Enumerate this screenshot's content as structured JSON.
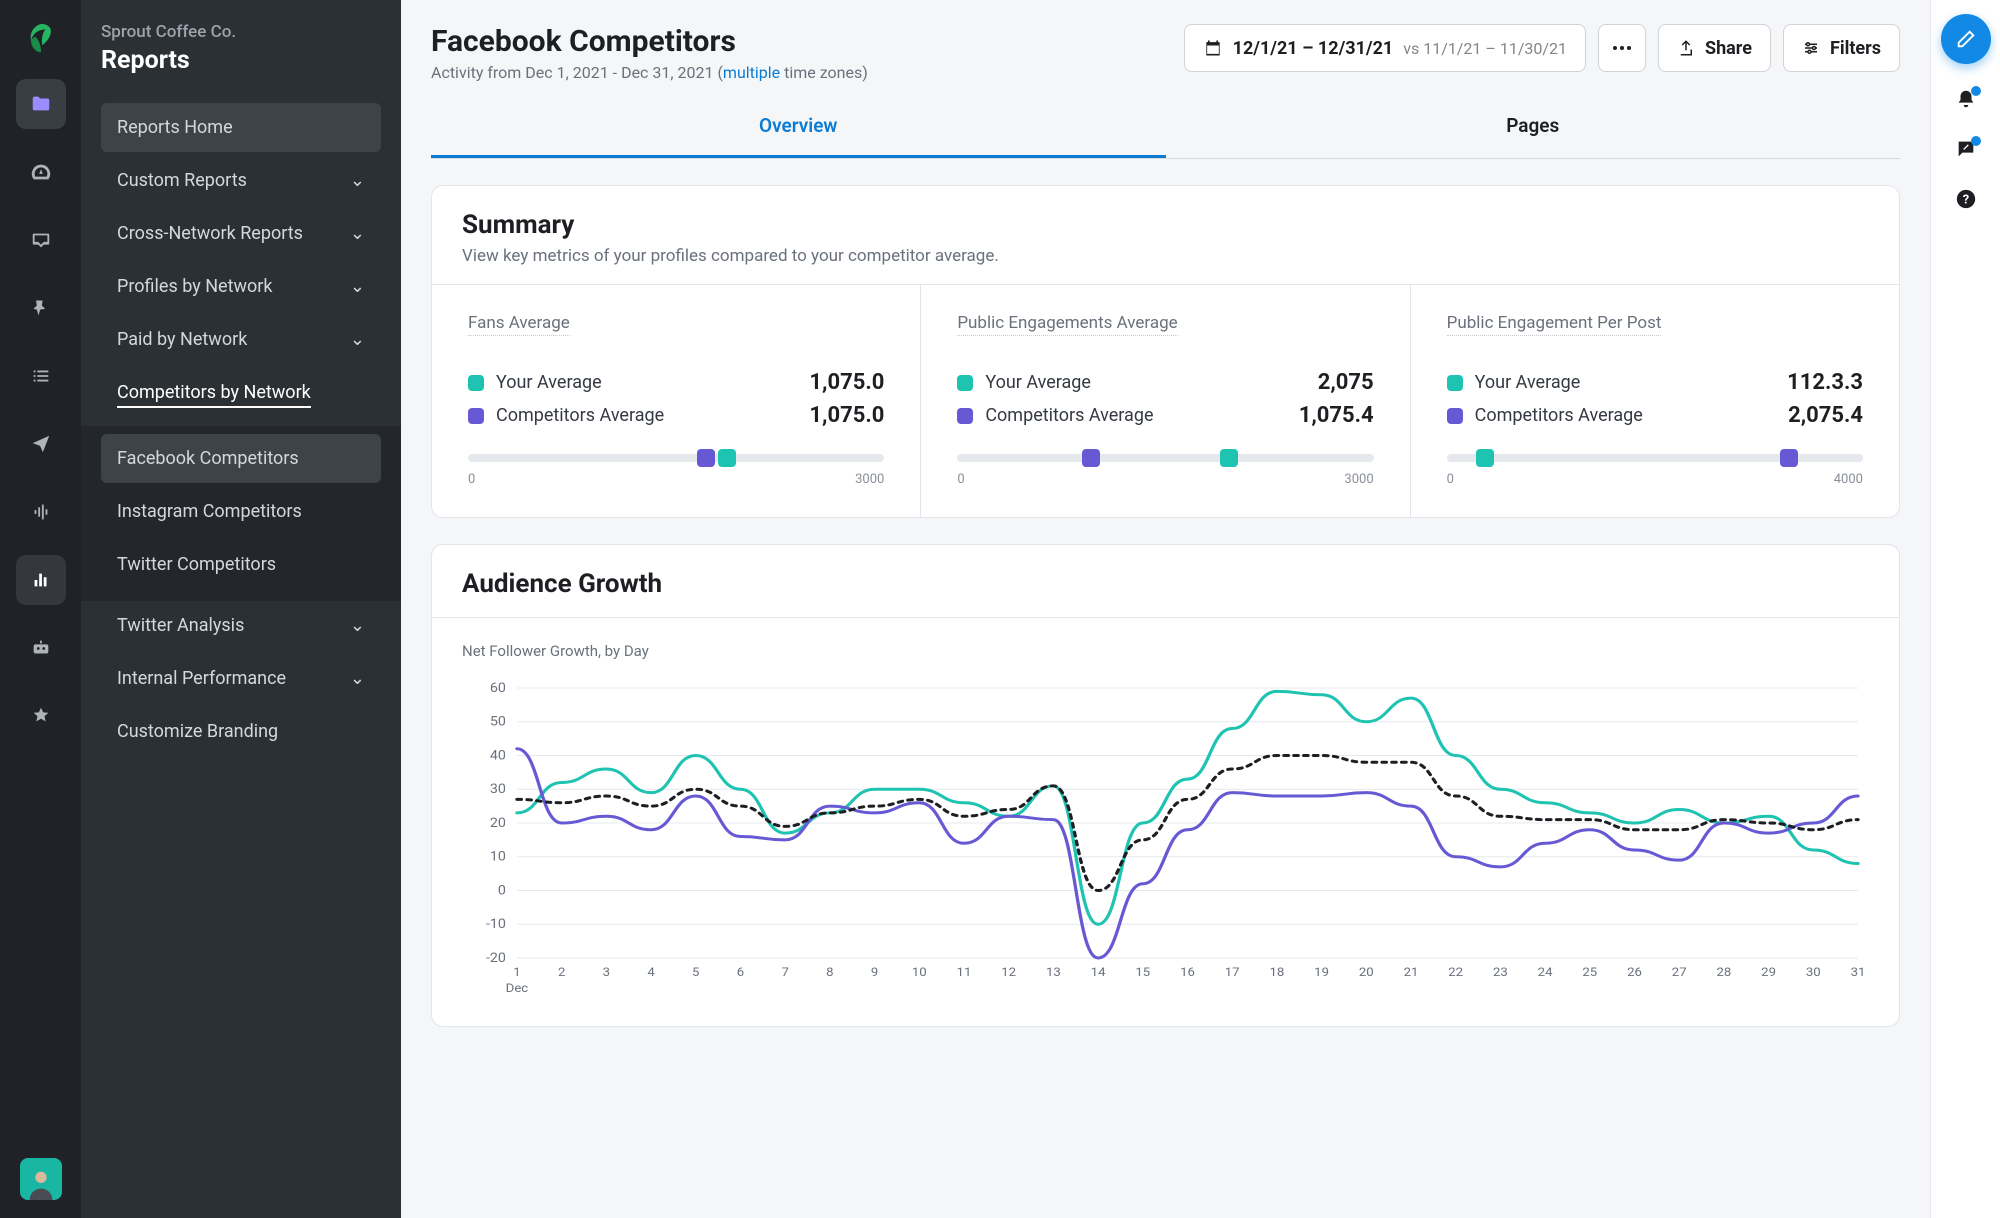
{
  "org": "Sprout Coffee Co.",
  "section": "Reports",
  "sidebar": {
    "home": "Reports Home",
    "items": [
      {
        "label": "Custom Reports"
      },
      {
        "label": "Cross-Network Reports"
      },
      {
        "label": "Profiles by Network"
      },
      {
        "label": "Paid by Network"
      },
      {
        "label": "Competitors by Network"
      }
    ],
    "sub": [
      {
        "label": "Facebook Competitors"
      },
      {
        "label": "Instagram Competitors"
      },
      {
        "label": "Twitter Competitors"
      }
    ],
    "tail": [
      {
        "label": "Twitter Analysis"
      },
      {
        "label": "Internal Performance"
      },
      {
        "label": "Customize Branding"
      }
    ]
  },
  "header": {
    "title": "Facebook Competitors",
    "activity_pre": "Activity from Dec 1, 2021 - Dec 31, 2021 (",
    "activity_link": "multiple",
    "activity_post": " time zones)",
    "date_main": "12/1/21 – 12/31/21",
    "date_compare": " vs 11/1/21 – 11/30/21",
    "share": "Share",
    "filters": "Filters"
  },
  "tabs": {
    "overview": "Overview",
    "pages": "Pages"
  },
  "summary": {
    "title": "Summary",
    "desc": "View key metrics of your profiles compared to your competitor average.",
    "your": "Your Average",
    "comp": "Competitors Average",
    "cells": [
      {
        "title": "Fans Average",
        "your": "1,075.0",
        "comp": "1,075.0",
        "min": "0",
        "max": "3000",
        "ypos": 60,
        "cpos": 55
      },
      {
        "title": "Public Engagements Average",
        "your": "2,075",
        "comp": "1,075.4",
        "min": "0",
        "max": "3000",
        "ypos": 63,
        "cpos": 30
      },
      {
        "title": "Public Engagement Per Post",
        "your": "112.3.3",
        "comp": "2,075.4",
        "min": "0",
        "max": "4000",
        "ypos": 7,
        "cpos": 80
      }
    ]
  },
  "growth": {
    "title": "Audience Growth",
    "sub": "Net Follower Growth, by Day",
    "xlabel": "Dec"
  },
  "chart_data": {
    "type": "line",
    "title": "Audience Growth",
    "subtitle": "Net Follower Growth, by Day",
    "xlabel": "Dec",
    "ylabel": "",
    "ylim": [
      -20,
      60
    ],
    "yticks": [
      -20,
      -10,
      0,
      10,
      20,
      30,
      40,
      50,
      60
    ],
    "x": [
      1,
      2,
      3,
      4,
      5,
      6,
      7,
      8,
      9,
      10,
      11,
      12,
      13,
      14,
      15,
      16,
      17,
      18,
      19,
      20,
      21,
      22,
      23,
      24,
      25,
      26,
      27,
      28,
      29,
      30,
      31
    ],
    "series": [
      {
        "name": "Your Average",
        "color": "#1fc3b1",
        "values": [
          23,
          32,
          36,
          29,
          40,
          30,
          17,
          23,
          30,
          30,
          26,
          22,
          31,
          -10,
          20,
          33,
          48,
          59,
          58,
          50,
          57,
          40,
          30,
          26,
          23,
          20,
          24,
          20,
          22,
          12,
          8
        ]
      },
      {
        "name": "Competitors Average",
        "color": "#6759d4",
        "values": [
          42,
          20,
          22,
          18,
          28,
          16,
          15,
          25,
          23,
          26,
          14,
          22,
          21,
          -20,
          2,
          18,
          29,
          28,
          28,
          29,
          25,
          10,
          7,
          14,
          18,
          12,
          9,
          20,
          17,
          20,
          28
        ]
      },
      {
        "name": "Dotted",
        "color": "#1d1f23",
        "dashed": true,
        "values": [
          27,
          26,
          28,
          25,
          30,
          25,
          19,
          23,
          25,
          27,
          22,
          24,
          31,
          0,
          15,
          27,
          36,
          40,
          40,
          38,
          38,
          28,
          22,
          21,
          21,
          18,
          18,
          21,
          20,
          18,
          21
        ]
      }
    ]
  }
}
